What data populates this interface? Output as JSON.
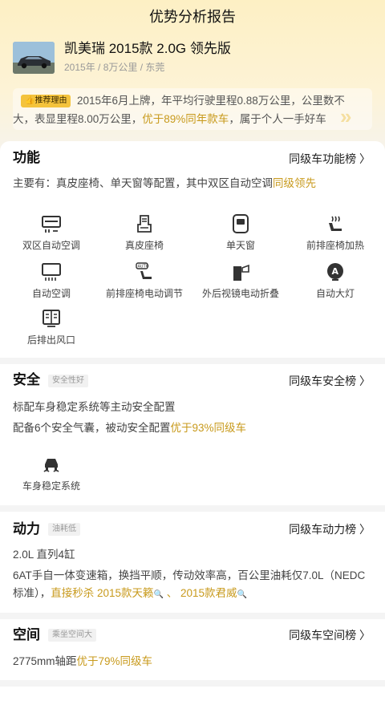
{
  "header": {
    "title": "优势分析报告"
  },
  "car": {
    "name": "凯美瑞 2015款 2.0G 领先版",
    "meta": "2015年 / 8万公里 / 东莞"
  },
  "reason": {
    "tag": "推荐理由",
    "text_a": "2015年6月上牌，年平均行驶里程0.88万公里，公里数不大，表显里程8.00万公里，",
    "text_hl": "优于89%同年款车",
    "text_b": "，属于个人一手好车"
  },
  "function": {
    "title": "功能",
    "link": "同级车功能榜 〉",
    "summary_a": "主要有：真皮座椅、单天窗等配置，其中双区自动空调",
    "summary_hl": "同级领先",
    "features": [
      {
        "label": "双区自动空调",
        "icon": "dual-zone-ac-icon"
      },
      {
        "label": "真皮座椅",
        "icon": "leather-seat-icon"
      },
      {
        "label": "单天窗",
        "icon": "sunroof-icon"
      },
      {
        "label": "前排座椅加热",
        "icon": "seat-heating-icon"
      },
      {
        "label": "自动空调",
        "icon": "auto-ac-icon"
      },
      {
        "label": "前排座椅电动调节",
        "icon": "power-seat-icon"
      },
      {
        "label": "外后视镜电动折叠",
        "icon": "mirror-fold-icon"
      },
      {
        "label": "自动大灯",
        "icon": "auto-headlight-icon"
      },
      {
        "label": "后排出风口",
        "icon": "rear-vent-icon"
      }
    ]
  },
  "safety": {
    "title": "安全",
    "badge": "安全性好",
    "link": "同级车安全榜 〉",
    "line1": "标配车身稳定系统等主动安全配置",
    "line2_a": "配备6个安全气囊，被动安全配置",
    "line2_hl": "优于93%同级车",
    "feature": {
      "label": "车身稳定系统",
      "icon": "stability-control-icon"
    }
  },
  "power": {
    "title": "动力",
    "badge": "油耗低",
    "link": "同级车动力榜 〉",
    "engine": "2.0L 直列4缸",
    "desc_a": "6AT手自一体变速箱，换挡平顺，传动效率高，百公里油耗仅7.0L（NEDC标准），",
    "desc_hl": "直接秒杀 2015款天籁",
    "sep": " 、 ",
    "desc_hl2": "2015款君威"
  },
  "space": {
    "title": "空间",
    "badge": "乘坐空间大",
    "link": "同级车空间榜 〉",
    "text_a": "2775mm轴距",
    "text_hl": "优于79%同级车"
  },
  "colors": {
    "accent": "#c89a1c",
    "tag": "#f4c33c",
    "hero": "#fdf0c4"
  }
}
